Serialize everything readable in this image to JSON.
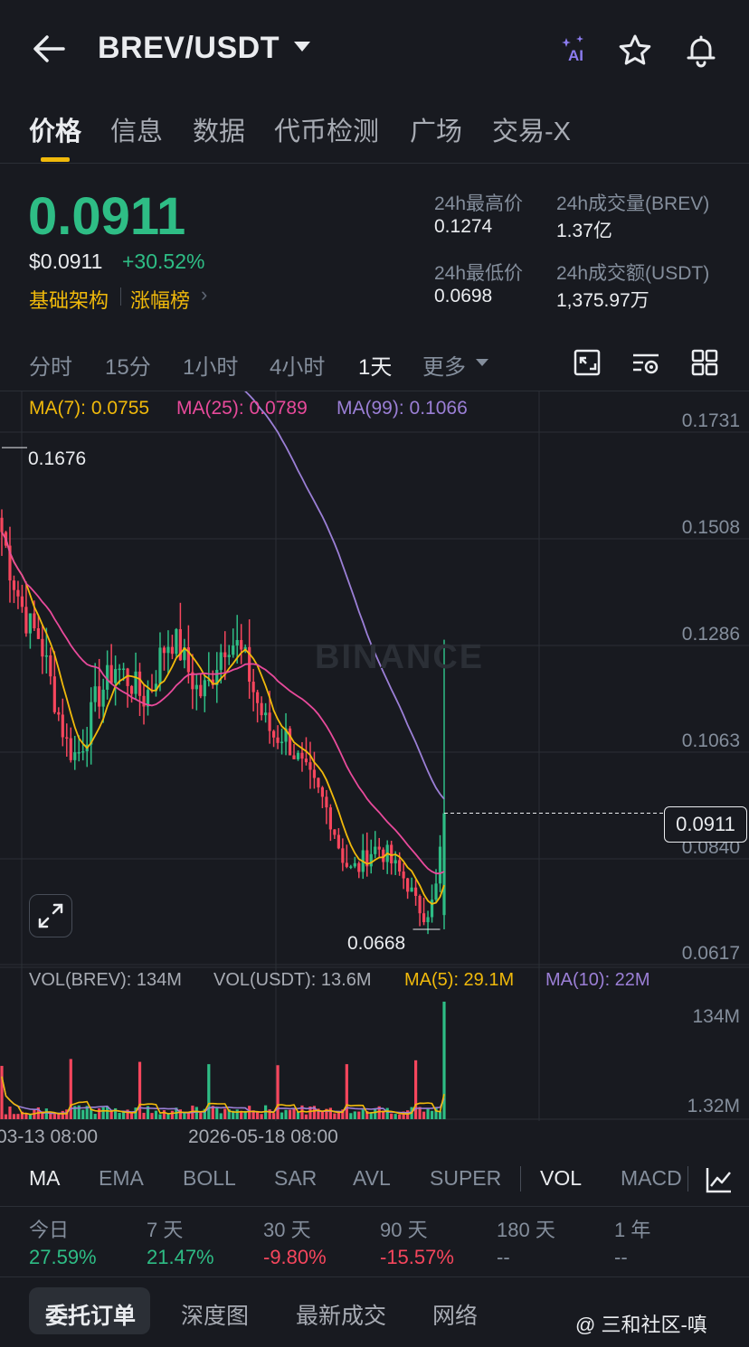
{
  "header": {
    "pair": "BREV/USDT",
    "ai_label": "AI"
  },
  "tabs": [
    "价格",
    "信息",
    "数据",
    "代币检测",
    "广场",
    "交易-X"
  ],
  "price": {
    "last": "0.0911",
    "usd": "$0.0911",
    "change": "+30.52%",
    "tag1": "基础架构",
    "tag2": "涨幅榜",
    "tag_arrow": "›"
  },
  "stats": {
    "high_label": "24h最高价",
    "high_value": "0.1274",
    "low_label": "24h最低价",
    "low_value": "0.0698",
    "vol_base_label": "24h成交量(BREV)",
    "vol_base_value": "1.37亿",
    "vol_quote_label": "24h成交额(USDT)",
    "vol_quote_value": "1,375.97万"
  },
  "timeframes": [
    "分时",
    "15分",
    "1小时",
    "4小时",
    "1天",
    "更多"
  ],
  "active_timeframe": "1天",
  "ma_legend": {
    "ma7": "MA(7): 0.0755",
    "ma25": "MA(25): 0.0789",
    "ma99": "MA(99): 0.1066"
  },
  "price_axis": [
    "0.1731",
    "0.1508",
    "0.1286",
    "0.1063",
    "0.0840",
    "0.0617"
  ],
  "annotations": {
    "high": "0.1676",
    "low": "0.0668",
    "current": "0.0911",
    "watermark": "BINANCE"
  },
  "vol_legend": {
    "vol_base": "VOL(BREV): 134M",
    "vol_quote": "VOL(USDT): 13.6M",
    "ma5": "MA(5): 29.1M",
    "ma10": "MA(10): 22M"
  },
  "vol_axis": [
    "134M",
    "1.32M"
  ],
  "time_axis": [
    "03-13 08:00",
    "2026-05-18 08:00"
  ],
  "indicators": [
    "MA",
    "EMA",
    "BOLL",
    "SAR",
    "AVL",
    "SUPER",
    "VOL",
    "MACD"
  ],
  "active_main_indicator": "MA",
  "active_sub_indicator": "VOL",
  "performance": [
    {
      "label": "今日",
      "value": "27.59%",
      "dir": "up"
    },
    {
      "label": "7 天",
      "value": "21.47%",
      "dir": "up"
    },
    {
      "label": "30 天",
      "value": "-9.80%",
      "dir": "down"
    },
    {
      "label": "90 天",
      "value": "-15.57%",
      "dir": "down"
    },
    {
      "label": "180 天",
      "value": "--",
      "dir": "none"
    },
    {
      "label": "1 年",
      "value": "--",
      "dir": "none"
    }
  ],
  "bottom_tabs": [
    "委托订单",
    "深度图",
    "最新成交",
    "网络"
  ],
  "watermark_text": "@ 三和社区-嗔",
  "colors": {
    "up": "#2ebd85",
    "down": "#f6465d",
    "accent": "#f0b90b",
    "ma7": "#f0b90b",
    "ma25": "#e84a9b",
    "ma99": "#9b7fd6"
  },
  "chart_data": {
    "type": "candlestick",
    "price_range": [
      0.0617,
      0.1731
    ],
    "high": 0.1676,
    "low": 0.0668,
    "last": 0.0911,
    "ohlc_close_trend": [
      0.15,
      0.142,
      0.135,
      0.13,
      0.128,
      0.12,
      0.112,
      0.105,
      0.103,
      0.108,
      0.115,
      0.118,
      0.122,
      0.12,
      0.118,
      0.115,
      0.118,
      0.125,
      0.128,
      0.125,
      0.12,
      0.116,
      0.118,
      0.124,
      0.128,
      0.126,
      0.122,
      0.115,
      0.11,
      0.107,
      0.108,
      0.104,
      0.1,
      0.097,
      0.094,
      0.09,
      0.083,
      0.079,
      0.08,
      0.083,
      0.084,
      0.082,
      0.079,
      0.077,
      0.072,
      0.07,
      0.073,
      0.0911
    ]
  }
}
